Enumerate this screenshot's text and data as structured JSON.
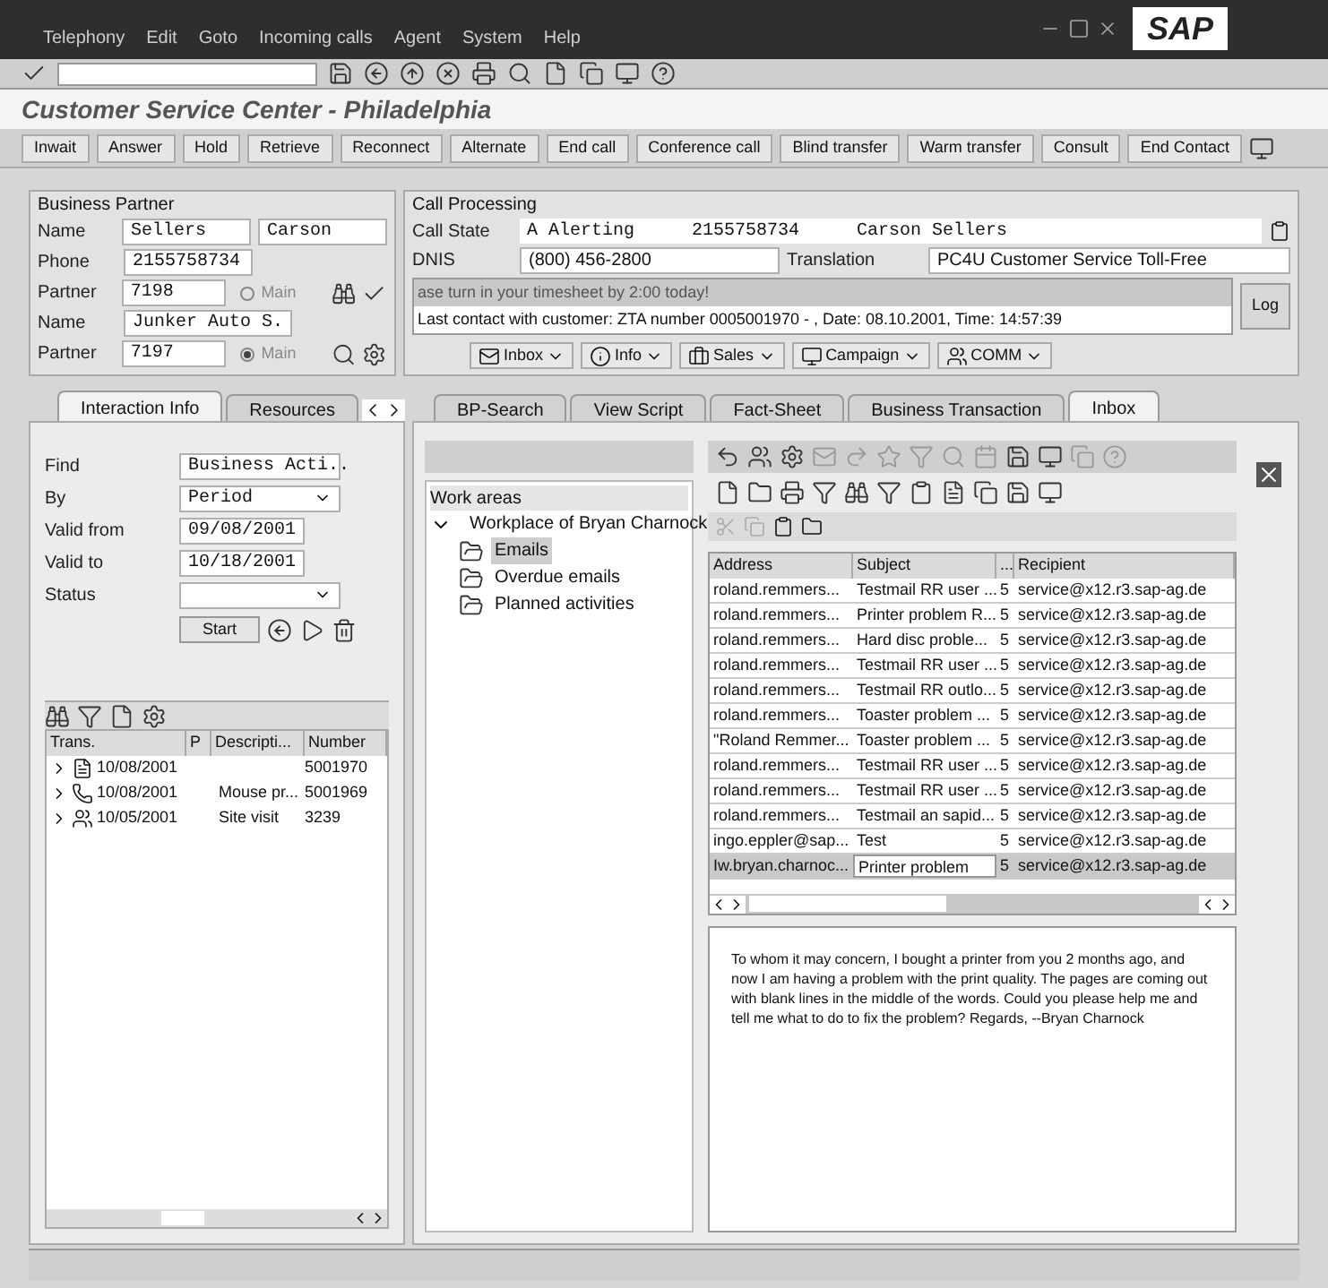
{
  "menu": [
    "Telephony",
    "Edit",
    "Goto",
    "Incoming calls",
    "Agent",
    "System",
    "Help"
  ],
  "logo": "SAP",
  "title": "Customer Service Center - Philadelphia",
  "call_buttons": [
    "Inwait",
    "Answer",
    "Hold",
    "Retrieve",
    "Reconnect",
    "Alternate",
    "End call",
    "Conference call",
    "Blind transfer",
    "Warm transfer",
    "Consult",
    "End Contact"
  ],
  "business_partner": {
    "title": "Business Partner",
    "rows": [
      {
        "kind": "text",
        "label": "Name",
        "values": [
          "Sellers",
          "Carson"
        ]
      },
      {
        "kind": "text",
        "label": "Phone",
        "values": [
          "2155758734"
        ]
      },
      {
        "kind": "partner",
        "label": "Partner",
        "value": "7198",
        "radio_label": "Main",
        "selected": false
      },
      {
        "kind": "text",
        "label": "Name",
        "values": [
          "Junker Auto S."
        ]
      },
      {
        "kind": "partner",
        "label": "Partner",
        "value": "7197",
        "radio_label": "Main",
        "selected": true
      }
    ]
  },
  "call_processing": {
    "title": "Call Processing",
    "state_label": "Call State",
    "state_values": [
      "A Alerting",
      "2155758734",
      "Carson Sellers"
    ],
    "dnis_label": "DNIS",
    "dnis_value": "(800) 456-2800",
    "translation_label": "Translation",
    "translation_value": "PC4U Customer Service Toll-Free",
    "messages": [
      "ase turn in your timesheet by 2:00 today!",
      "Last contact with customer: ZTA number 0005001970 - , Date: 08.10.2001, Time: 14:57:39"
    ],
    "log_button": "Log",
    "quick_buttons": [
      "Inbox",
      "Info",
      "Sales",
      "Campaign",
      "COMM"
    ]
  },
  "left_tabs": [
    {
      "label": "Interaction Info",
      "selected": true
    },
    {
      "label": "Resources",
      "selected": false
    }
  ],
  "search_form": {
    "rows": [
      {
        "kind": "dropdown",
        "label": "Find",
        "value": "Business Acti.."
      },
      {
        "kind": "dropdown",
        "label": "By",
        "value": "Period"
      },
      {
        "kind": "date",
        "label": "Valid from",
        "value": "09/08/2001"
      },
      {
        "kind": "date",
        "label": "Valid to",
        "value": "10/18/2001"
      },
      {
        "kind": "dropdown",
        "label": "Status"
      }
    ],
    "start_button": "Start"
  },
  "transactions": {
    "columns": [
      "Trans.",
      "P",
      "Descripti...",
      "Number"
    ],
    "rows": [
      {
        "kind": "document",
        "date": "10/08/2001",
        "number": "5001970"
      },
      {
        "kind": "phone",
        "date": "10/08/2001",
        "description": "Mouse pr...",
        "number": "5001969"
      },
      {
        "kind": "visit",
        "date": "10/05/2001",
        "description": "Site visit",
        "number": "3239"
      }
    ]
  },
  "main_tabs": [
    {
      "label": "BP-Search",
      "selected": false
    },
    {
      "label": "View Script",
      "selected": false
    },
    {
      "label": "Fact-Sheet",
      "selected": false
    },
    {
      "label": "Business Transaction",
      "selected": false
    },
    {
      "label": "Inbox",
      "selected": true
    }
  ],
  "work_areas": {
    "title": "Work areas",
    "tree": [
      {
        "label": "Workplace of Bryan Charnock",
        "expanded": true,
        "children": [
          {
            "label": "Emails",
            "selected": true
          },
          {
            "label": "Overdue emails",
            "selected": false
          },
          {
            "label": "Planned activities",
            "selected": false
          }
        ]
      }
    ]
  },
  "inbox": {
    "columns": [
      "Address",
      "Subject",
      "...",
      "Recipient"
    ],
    "rows": [
      {
        "address": "roland.remmers...",
        "subject": "Testmail RR user ...",
        "column_3": "5",
        "recipient": "service@x12.r3.sap-ag.de",
        "selected": false
      },
      {
        "address": "roland.remmers...",
        "subject": "Printer problem R...",
        "column_3": "5",
        "recipient": "service@x12.r3.sap-ag.de",
        "selected": false
      },
      {
        "address": "roland.remmers...",
        "subject": "Hard disc proble...",
        "column_3": "5",
        "recipient": "service@x12.r3.sap-ag.de",
        "selected": false
      },
      {
        "address": "roland.remmers...",
        "subject": "Testmail RR user ...",
        "column_3": "5",
        "recipient": "service@x12.r3.sap-ag.de",
        "selected": false
      },
      {
        "address": "roland.remmers...",
        "subject": "Testmail RR outlo...",
        "column_3": "5",
        "recipient": "service@x12.r3.sap-ag.de",
        "selected": false
      },
      {
        "address": "roland.remmers...",
        "subject": "Toaster problem ...",
        "column_3": "5",
        "recipient": "service@x12.r3.sap-ag.de",
        "selected": false
      },
      {
        "address": "\"Roland Remmer...",
        "subject": "Toaster problem ...",
        "column_3": "5",
        "recipient": "service@x12.r3.sap-ag.de",
        "selected": false
      },
      {
        "address": "roland.remmers...",
        "subject": "Testmail RR user ...",
        "column_3": "5",
        "recipient": "service@x12.r3.sap-ag.de",
        "selected": false
      },
      {
        "address": "roland.remmers...",
        "subject": "Testmail RR user ...",
        "column_3": "5",
        "recipient": "service@x12.r3.sap-ag.de",
        "selected": false
      },
      {
        "address": "roland.remmers...",
        "subject": "Testmail an sapid...",
        "column_3": "5",
        "recipient": "service@x12.r3.sap-ag.de",
        "selected": false
      },
      {
        "address": "ingo.eppler@sap...",
        "subject": "Test",
        "column_3": "5",
        "recipient": "service@x12.r3.sap-ag.de",
        "selected": false
      },
      {
        "address": "Iw.bryan.charnoc...",
        "subject": "Printer problem",
        "column_3": "5",
        "recipient": "service@x12.r3.sap-ag.de",
        "selected": true
      }
    ],
    "body": "To whom it may concern, I bought a printer from you 2 months ago, and now I am having a problem with the print quality. The pages are coming out with blank lines in the middle of the words. Could you please help me and tell me what to do to fix the problem? Regards, --Bryan Charnock"
  }
}
